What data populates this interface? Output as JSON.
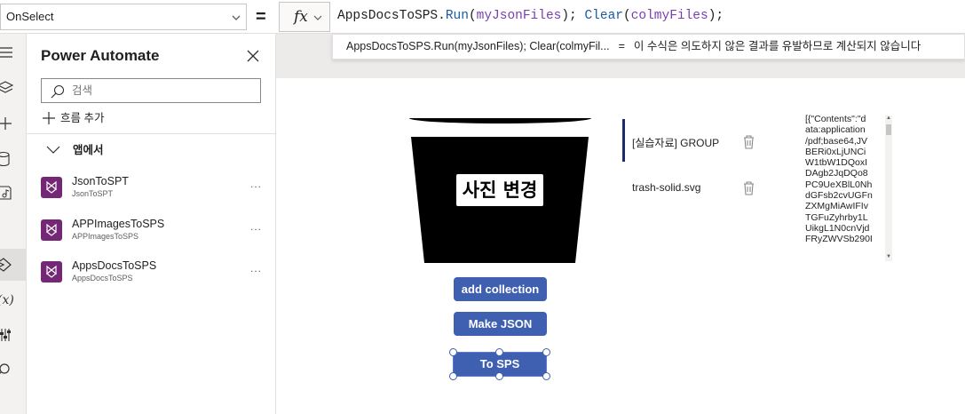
{
  "formula_bar": {
    "property": "OnSelect",
    "eq": "=",
    "fx": "fx",
    "formula_tokens": [
      {
        "t": "AppsDocsToSPS",
        "c": "tok-p"
      },
      {
        "t": ".",
        "c": "tok-p"
      },
      {
        "t": "Run",
        "c": "tok-fn"
      },
      {
        "t": "(",
        "c": "tok-p"
      },
      {
        "t": "myJsonFiles",
        "c": "tok-id"
      },
      {
        "t": "); ",
        "c": "tok-p"
      },
      {
        "t": "Clear",
        "c": "tok-fn"
      },
      {
        "t": "(",
        "c": "tok-p"
      },
      {
        "t": "colmyFiles",
        "c": "tok-id"
      },
      {
        "t": ");",
        "c": "tok-p"
      }
    ],
    "error_expression": "AppsDocsToSPS.Run(myJsonFiles); Clear(colmyFil...",
    "error_eq": "=",
    "error_message": "이 수식은 의도하지 않은 결과를 유발하므로 계산되지 않습니다"
  },
  "left_rail": {
    "icons": [
      "menu-icon",
      "layers-icon",
      "plus-icon",
      "database-icon",
      "media-icon",
      "power-automate-icon",
      "variables-icon",
      "tools-icon",
      "search-icon"
    ]
  },
  "power_automate": {
    "title": "Power Automate",
    "search_placeholder": "검색",
    "add_flow": "흐름 추가",
    "section": "앱에서",
    "flows": [
      {
        "name": "JsonToSPT",
        "sub": "JsonToSPT"
      },
      {
        "name": "APPImagesToSPS",
        "sub": "APPImagesToSPS"
      },
      {
        "name": "AppsDocsToSPS",
        "sub": "AppsDocsToSPS"
      }
    ],
    "more": "..."
  },
  "canvas": {
    "photo_label": "사진 변경",
    "buttons": {
      "add_collection": "add collection",
      "make_json": "Make JSON",
      "to_sps": "To SPS"
    },
    "gallery": [
      {
        "name": "[실습자료] GROUP"
      },
      {
        "name": "trash-solid.svg"
      }
    ],
    "json_lines": [
      "[{\"Contents\":\"d",
      "ata:application",
      "/pdf;base64,JV",
      "BERi0xLjUNCi",
      "W1tbW1DQoxI",
      "DAgb2JqDQo8",
      "PC9UeXBlL0Nh",
      "dGFsb2cvUGFn",
      "ZXMgMiAwIFIv",
      "TGFuZyhrby1L",
      "UikgL1N0cnVjd",
      "FRyZWVSb290I"
    ]
  },
  "colors": {
    "button": "#3f5fb0",
    "flow_logo": "#742774",
    "function_token": "#1a5ba3",
    "identifier_token": "#7a3eb1"
  }
}
